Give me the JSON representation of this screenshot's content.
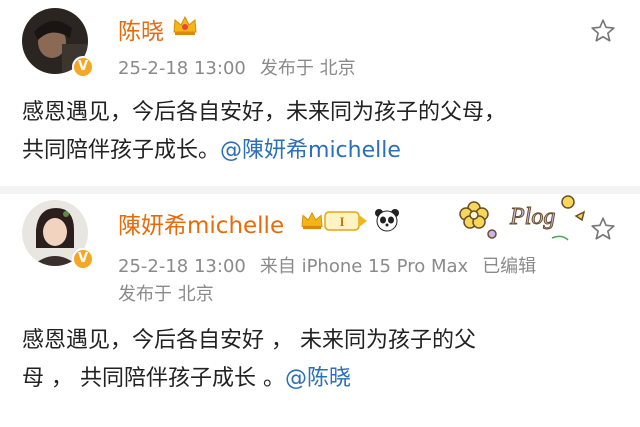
{
  "posts": [
    {
      "author": "陈晓",
      "date": "25-2-18 13:00",
      "location": "发布于 北京",
      "text_line1": "感恩遇见，今后各自安好，未来同为孩子的父母，",
      "text_line2": "共同陪伴孩子成长。",
      "mention": "@陳妍希michelle",
      "verified_mark": "V"
    },
    {
      "author": "陳妍希michelle",
      "date": "25-2-18 13:00",
      "source": "来自 iPhone 15 Pro Max",
      "edited": "已编辑",
      "location": "发布于 北京",
      "text_line1": "感恩遇见，今后各自安好 ，  未来同为孩子的父",
      "text_line2": "母 ， 共同陪伴孩子成长 。",
      "mention": "@陈晓",
      "verified_mark": "V",
      "level_badge": "I",
      "sticker_text": "Plog"
    }
  ],
  "icons": [
    "crown-icon",
    "star-icon",
    "panda-icon",
    "level-badge-icon",
    "flower-icon",
    "verified-icon"
  ],
  "colors": {
    "name": "#e86b0a",
    "meta": "#8a8a8a",
    "link": "#2a6fb8",
    "verified": "#f5a623"
  }
}
